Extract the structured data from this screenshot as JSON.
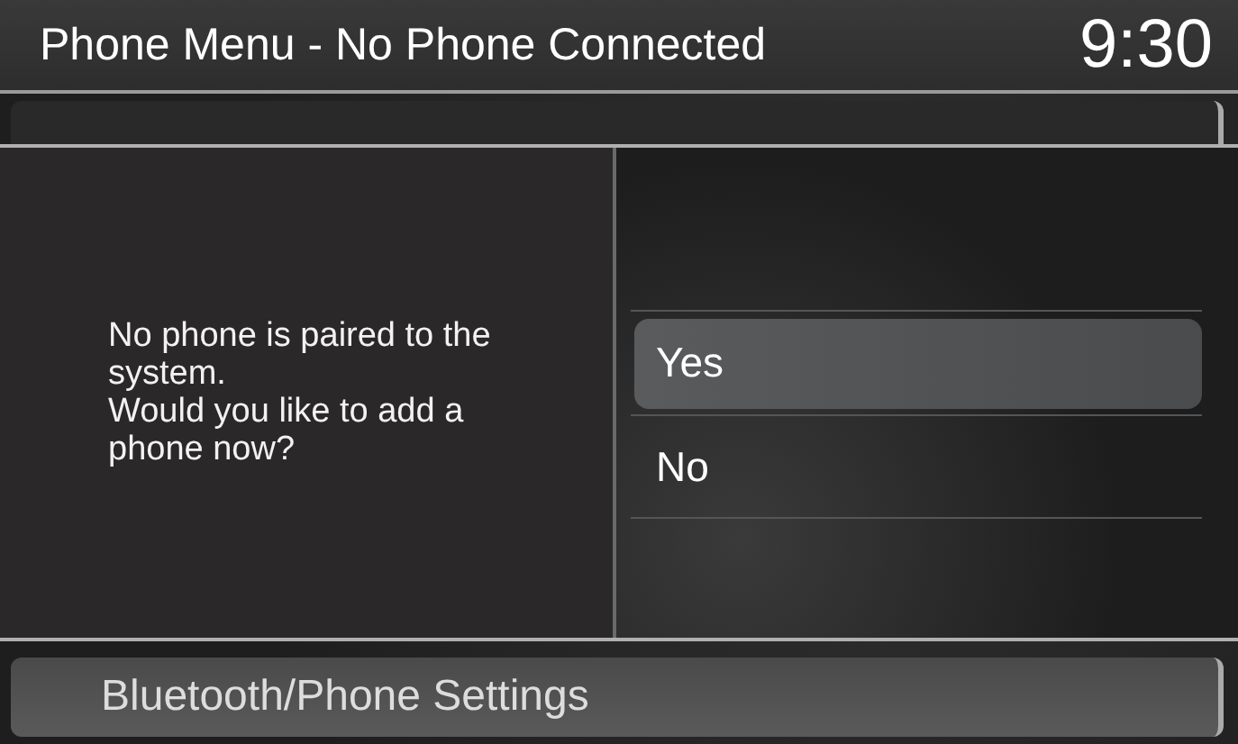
{
  "header": {
    "title": "Phone Menu - No Phone Connected",
    "time": "9:30"
  },
  "menu": {
    "items": [
      {
        "label": "Bluetooth/Phone Settings"
      }
    ]
  },
  "dialog": {
    "message": "No phone is paired to the system.\nWould you like to add a phone now?",
    "options": [
      {
        "label": "Yes",
        "selected": true
      },
      {
        "label": "No",
        "selected": false
      }
    ]
  }
}
